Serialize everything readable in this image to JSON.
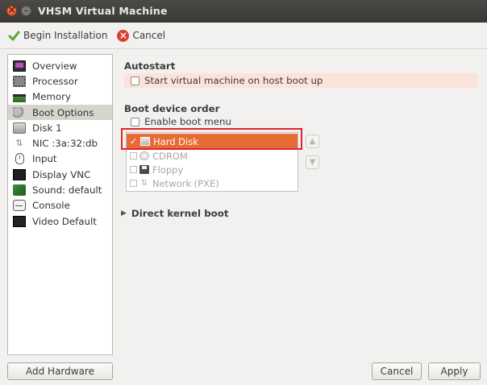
{
  "window": {
    "title": "VHSM Virtual Machine"
  },
  "toolbar": {
    "begin_label": "Begin Installation",
    "cancel_label": "Cancel"
  },
  "sidebar": {
    "items": [
      {
        "label": "Overview",
        "icon": "monitor-icon"
      },
      {
        "label": "Processor",
        "icon": "cpu-icon"
      },
      {
        "label": "Memory",
        "icon": "memory-icon"
      },
      {
        "label": "Boot Options",
        "icon": "gears-icon",
        "selected": true
      },
      {
        "label": "Disk 1",
        "icon": "disk-icon"
      },
      {
        "label": "NIC :3a:32:db",
        "icon": "network-icon"
      },
      {
        "label": "Input",
        "icon": "mouse-icon"
      },
      {
        "label": "Display VNC",
        "icon": "display-icon"
      },
      {
        "label": "Sound: default",
        "icon": "sound-icon"
      },
      {
        "label": "Console",
        "icon": "console-icon"
      },
      {
        "label": "Video Default",
        "icon": "video-icon"
      }
    ],
    "add_hardware_label": "Add Hardware"
  },
  "main": {
    "autostart": {
      "title": "Autostart",
      "checkbox_label": "Start virtual machine on host boot up",
      "checked": false
    },
    "boot_order": {
      "title": "Boot device order",
      "enable_menu_label": "Enable boot menu",
      "enable_menu_checked": false,
      "devices": [
        {
          "label": "Hard Disk",
          "checked": true,
          "icon": "hard-disk-icon"
        },
        {
          "label": "CDROM",
          "checked": false,
          "icon": "cdrom-icon"
        },
        {
          "label": "Floppy",
          "checked": false,
          "icon": "floppy-icon"
        },
        {
          "label": "Network (PXE)",
          "checked": false,
          "icon": "network-icon"
        }
      ]
    },
    "direct_kernel_boot_label": "Direct kernel boot"
  },
  "footer": {
    "cancel_label": "Cancel",
    "apply_label": "Apply"
  },
  "colors": {
    "accent": "#e76b34",
    "highlight_border": "#e0252b",
    "titlebar": "#3c3b37"
  }
}
